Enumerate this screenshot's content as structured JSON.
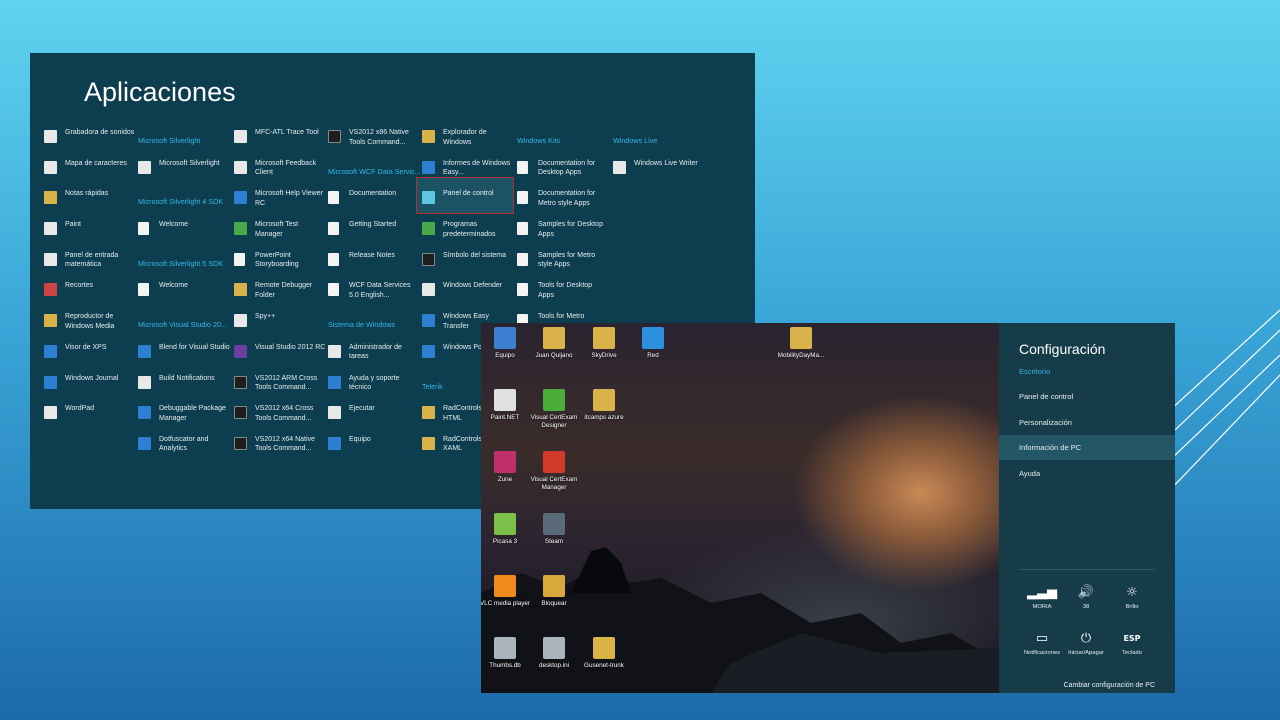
{
  "apps": {
    "title": "Aplicaciones",
    "columns": [
      [
        {
          "type": "app",
          "label": "Grabadora de sonidos",
          "icon": "microphone-icon",
          "color": "white"
        },
        {
          "type": "app",
          "label": "Mapa de caracteres",
          "icon": "character-map-icon",
          "color": "white"
        },
        {
          "type": "app",
          "label": "Notas rápidas",
          "icon": "sticky-notes-icon",
          "color": "yellow"
        },
        {
          "type": "app",
          "label": "Paint",
          "icon": "paint-icon",
          "color": "white"
        },
        {
          "type": "app",
          "label": "Panel de entrada matemática",
          "icon": "math-input-icon",
          "color": "white"
        },
        {
          "type": "app",
          "label": "Recortes",
          "icon": "scissors-icon",
          "color": "red"
        },
        {
          "type": "app",
          "label": "Reproductor de Windows Media",
          "icon": "media-player-icon",
          "color": "yellow"
        },
        {
          "type": "app",
          "label": "Visor de XPS",
          "icon": "xps-viewer-icon",
          "color": "blue"
        },
        {
          "type": "app",
          "label": "Windows Journal",
          "icon": "journal-icon",
          "color": "blue"
        },
        {
          "type": "app",
          "label": "WordPad",
          "icon": "wordpad-icon",
          "color": "white"
        }
      ],
      [
        {
          "type": "group",
          "label": "Microsoft Silverlight"
        },
        {
          "type": "app",
          "label": "Microsoft Silverlight",
          "icon": "silverlight-icon",
          "color": "white"
        },
        {
          "type": "group",
          "label": "Microsoft Silverlight 4 SDK"
        },
        {
          "type": "app",
          "label": "Welcome",
          "icon": "document-icon",
          "color": "doc"
        },
        {
          "type": "group",
          "label": "Microsoft Silverlight 5 SDK"
        },
        {
          "type": "app",
          "label": "Welcome",
          "icon": "document-icon",
          "color": "doc"
        },
        {
          "type": "group",
          "label": "Microsoft Visual Studio 20..."
        },
        {
          "type": "app",
          "label": "Blend for Visual Studio",
          "icon": "blend-icon",
          "color": "blue"
        },
        {
          "type": "app",
          "label": "Build Notifications",
          "icon": "build-icon",
          "color": "white"
        },
        {
          "type": "app",
          "label": "Debuggable Package Manager",
          "icon": "package-manager-icon",
          "color": "blue"
        },
        {
          "type": "app",
          "label": "Dotfuscator and Analytics",
          "icon": "dotfuscator-icon",
          "color": "blue"
        }
      ],
      [
        {
          "type": "app",
          "label": "MFC-ATL Trace Tool",
          "icon": "trace-tool-icon",
          "color": "white"
        },
        {
          "type": "app",
          "label": "Microsoft Feedback Client",
          "icon": "feedback-icon",
          "color": "white"
        },
        {
          "type": "app",
          "label": "Microsoft Help Viewer RC",
          "icon": "help-icon",
          "color": "blue"
        },
        {
          "type": "app",
          "label": "Microsoft Test Manager",
          "icon": "test-manager-icon",
          "color": "green"
        },
        {
          "type": "app",
          "label": "PowerPoint Storyboarding",
          "icon": "document-icon",
          "color": "doc"
        },
        {
          "type": "app",
          "label": "Remote Debugger Folder",
          "icon": "folder-icon",
          "color": "yellow"
        },
        {
          "type": "app",
          "label": "Spy++",
          "icon": "spy-icon",
          "color": "white"
        },
        {
          "type": "app",
          "label": "Visual Studio 2012 RC",
          "icon": "visual-studio-icon",
          "color": "purple"
        },
        {
          "type": "app",
          "label": "VS2012 ARM Cross Tools Command...",
          "icon": "command-prompt-icon",
          "color": "dark"
        },
        {
          "type": "app",
          "label": "VS2012 x64 Cross Tools Command...",
          "icon": "command-prompt-icon",
          "color": "dark"
        },
        {
          "type": "app",
          "label": "VS2012 x64 Native Tools Command...",
          "icon": "command-prompt-icon",
          "color": "dark"
        }
      ],
      [
        {
          "type": "app",
          "label": "VS2012 x86 Native Tools Command...",
          "icon": "command-prompt-icon",
          "color": "dark"
        },
        {
          "type": "group",
          "label": "Microsoft WCF Data Servic..."
        },
        {
          "type": "app",
          "label": "Documentation",
          "icon": "document-icon",
          "color": "doc"
        },
        {
          "type": "app",
          "label": "Getting Started",
          "icon": "document-icon",
          "color": "doc"
        },
        {
          "type": "app",
          "label": "Release Notes",
          "icon": "document-icon",
          "color": "doc"
        },
        {
          "type": "app",
          "label": "WCF Data Services 5.0 English...",
          "icon": "document-icon",
          "color": "doc"
        },
        {
          "type": "group",
          "label": "Sistema de Windows"
        },
        {
          "type": "app",
          "label": "Administrador de tareas",
          "icon": "task-manager-icon",
          "color": "white"
        },
        {
          "type": "app",
          "label": "Ayuda y soporte técnico",
          "icon": "help-support-icon",
          "color": "blue"
        },
        {
          "type": "app",
          "label": "Ejecutar",
          "icon": "run-icon",
          "color": "white"
        },
        {
          "type": "app",
          "label": "Equipo",
          "icon": "computer-icon",
          "color": "blue"
        }
      ],
      [
        {
          "type": "app",
          "label": "Explorador de Windows",
          "icon": "folder-icon",
          "color": "yellow"
        },
        {
          "type": "app",
          "label": "Informes de Windows Easy...",
          "icon": "globe-icon",
          "color": "blue"
        },
        {
          "type": "app",
          "label": "Panel de control",
          "icon": "control-panel-icon",
          "color": "cyan"
        },
        {
          "type": "app",
          "label": "Programas predeterminados",
          "icon": "default-programs-icon",
          "color": "green"
        },
        {
          "type": "app",
          "label": "Símbolo del sistema",
          "icon": "command-prompt-icon",
          "color": "dark"
        },
        {
          "type": "app",
          "label": "Windows Defender",
          "icon": "defender-icon",
          "color": "white"
        },
        {
          "type": "app",
          "label": "Windows Easy Transfer",
          "icon": "easy-transfer-icon",
          "color": "blue"
        },
        {
          "type": "app",
          "label": "Windows PowerShell",
          "icon": "powershell-icon",
          "color": "blue"
        },
        {
          "type": "group",
          "label": "Telerik"
        },
        {
          "type": "app",
          "label": "RadControls for Metro HTML",
          "icon": "folder-icon",
          "color": "yellow"
        },
        {
          "type": "app",
          "label": "RadControls for Metro XAML",
          "icon": "folder-icon",
          "color": "yellow"
        }
      ],
      [
        {
          "type": "group",
          "label": "Windows Kits"
        },
        {
          "type": "app",
          "label": "Documentation for Desktop Apps",
          "icon": "document-icon",
          "color": "doc"
        },
        {
          "type": "app",
          "label": "Documentation for Metro style Apps",
          "icon": "document-icon",
          "color": "doc"
        },
        {
          "type": "app",
          "label": "Samples for Desktop Apps",
          "icon": "document-icon",
          "color": "doc"
        },
        {
          "type": "app",
          "label": "Samples for Metro style Apps",
          "icon": "document-icon",
          "color": "doc"
        },
        {
          "type": "app",
          "label": "Tools for Desktop Apps",
          "icon": "document-icon",
          "color": "doc"
        },
        {
          "type": "app",
          "label": "Tools for Metro",
          "icon": "document-icon",
          "color": "doc"
        }
      ],
      [
        {
          "type": "group",
          "label": "Windows Live"
        },
        {
          "type": "app",
          "label": "Windows Live Writer",
          "icon": "live-writer-icon",
          "color": "white"
        }
      ]
    ]
  },
  "desktop": {
    "icons": [
      {
        "label": "Equipo",
        "icon": "computer-icon",
        "color": "#3c7fd0"
      },
      {
        "label": "Juan Quijano",
        "icon": "user-folder-icon",
        "color": "#d9b24a"
      },
      {
        "label": "SkyDrive",
        "icon": "skydrive-icon",
        "color": "#d9b24a"
      },
      {
        "label": "Red",
        "icon": "network-icon",
        "color": "#2d8fe0"
      },
      {
        "label": "MobilityDayMa...",
        "icon": "folder-icon",
        "color": "#d9b24a"
      },
      {
        "label": "Paint.NET",
        "icon": "paintnet-icon",
        "color": "#e0e0e0"
      },
      {
        "label": "Visual CertExam Designer",
        "icon": "certexam-designer-icon",
        "color": "#4cae3a"
      },
      {
        "label": "itcamps azure",
        "icon": "folder-icon",
        "color": "#d9b24a"
      },
      {
        "label": "Zune",
        "icon": "zune-icon",
        "color": "#c0306a"
      },
      {
        "label": "Visual CertExam Manager",
        "icon": "certexam-manager-icon",
        "color": "#d33a2a"
      },
      {
        "label": "Picasa 3",
        "icon": "picasa-icon",
        "color": "#7cc04a"
      },
      {
        "label": "Steam",
        "icon": "steam-icon",
        "color": "#5a6a78"
      },
      {
        "label": "VLC media player",
        "icon": "vlc-icon",
        "color": "#f08a1a"
      },
      {
        "label": "Bloquear",
        "icon": "lock-icon",
        "color": "#d9a83a"
      },
      {
        "label": "Thumbs.db",
        "icon": "file-icon",
        "color": "#aab4bc"
      },
      {
        "label": "desktop.ini",
        "icon": "gear-file-icon",
        "color": "#aab4bc"
      },
      {
        "label": "Gusenet-trunk",
        "icon": "folder-icon",
        "color": "#d9b24a"
      }
    ]
  },
  "charm": {
    "title": "Configuración",
    "subtitle": "Escritorio",
    "items": [
      "Panel de control",
      "Personalización",
      "Información de PC",
      "Ayuda"
    ],
    "active_item": "Información de PC",
    "quick": [
      {
        "label": "MORIA",
        "icon": "wifi-signal-icon",
        "glyph": "▂▃▅"
      },
      {
        "label": "38",
        "icon": "volume-icon",
        "glyph": "🔊"
      },
      {
        "label": "Brillo",
        "icon": "brightness-icon",
        "glyph": "☼"
      },
      {
        "label": "Notificaciones",
        "icon": "notifications-icon",
        "glyph": "▭"
      },
      {
        "label": "Iniciar/Apagar",
        "icon": "power-icon",
        "glyph": "⏻"
      },
      {
        "label": "Teclado",
        "icon": "keyboard-icon",
        "glyph": "ESP"
      }
    ],
    "footer": "Cambiar configuración de PC"
  }
}
